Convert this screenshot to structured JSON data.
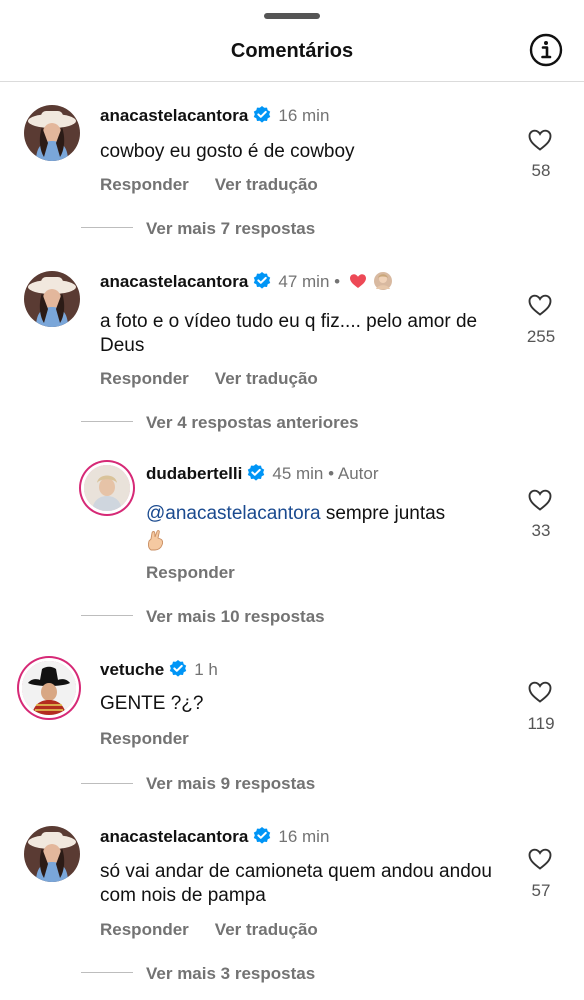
{
  "header": {
    "title": "Comentários"
  },
  "comments": [
    {
      "user": "anacastelacantora",
      "time": "16 min",
      "text": "cowboy eu gosto é de cowboy",
      "likes": "58",
      "reply": "Responder",
      "translate": "Ver tradução",
      "more": "Ver mais 7 respostas"
    },
    {
      "user": "anacastelacantora",
      "time": "47 min",
      "text": "a foto e o vídeo tudo eu q fiz.... pelo amor de Deus",
      "likes": "255",
      "reply": "Responder",
      "translate": "Ver tradução",
      "more": "Ver 4 respostas anteriores",
      "dot": "•"
    },
    {
      "user": "dudabertelli",
      "time": "45 min",
      "author": "Autor",
      "mention": "@anacastelacantora",
      "text": " sempre juntas",
      "likes": "33",
      "reply": "Responder",
      "more": "Ver mais 10 respostas",
      "dot": "•"
    },
    {
      "user": "vetuche",
      "time": "1 h",
      "text": "GENTE ?¿?",
      "likes": "119",
      "reply": "Responder",
      "more": "Ver mais 9 respostas"
    },
    {
      "user": "anacastelacantora",
      "time": "16 min",
      "text": "só vai andar de camioneta quem andou andou com nois de pampa",
      "likes": "57",
      "reply": "Responder",
      "translate": "Ver tradução",
      "more": "Ver mais 3 respostas"
    }
  ],
  "colors": {
    "verified": "#0095f6",
    "heart_red": "#ed4956",
    "ring": "#d62976"
  },
  "icons": {
    "info": "info-icon",
    "heart": "heart-outline-icon",
    "verified": "verified-badge-icon"
  }
}
